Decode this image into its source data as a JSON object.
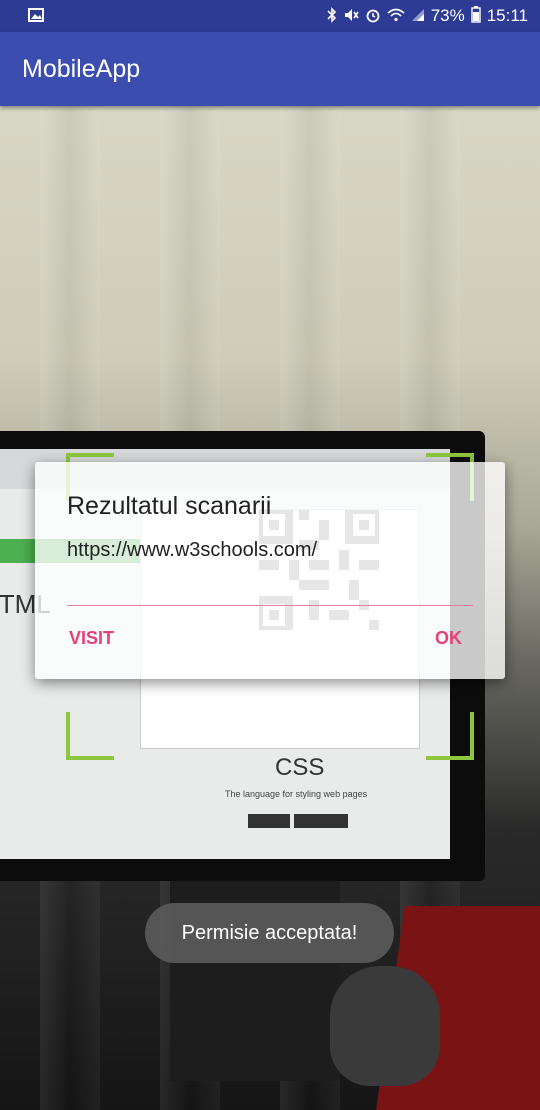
{
  "status_bar": {
    "left_icons": [
      "image-icon"
    ],
    "right_icons": [
      "bluetooth-icon",
      "mute-icon",
      "alarm-icon",
      "wifi-icon",
      "signal-icon"
    ],
    "battery_percent": "73%",
    "time": "15:11"
  },
  "app_bar": {
    "title": "MobileApp"
  },
  "colors": {
    "status_bar": "#2e3b94",
    "app_bar": "#3b4eaf",
    "accent": "#e5407a",
    "scanner_corner": "#8ec63f"
  },
  "camera_preview": {
    "screen_text_html": "HTML",
    "screen_text_css": "CSS",
    "screen_text_css_sub": "The language for styling web pages"
  },
  "dialog": {
    "title": "Rezultatul scanarii",
    "message": "https://www.w3schools.com/",
    "negative_button": "VISIT",
    "positive_button": "OK"
  },
  "toast": {
    "text": "Permisie acceptata!"
  }
}
